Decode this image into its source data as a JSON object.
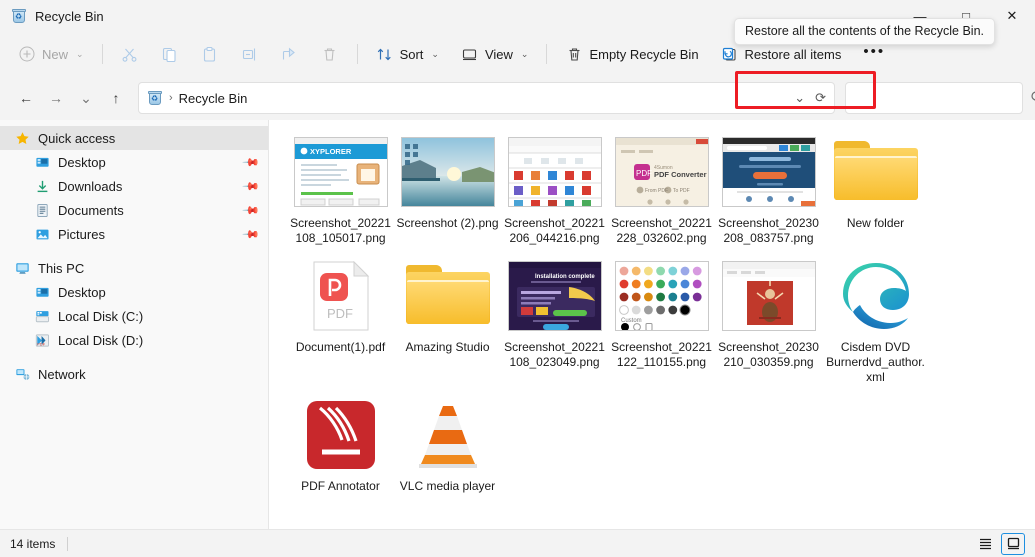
{
  "window": {
    "title": "Recycle Bin",
    "icon": "recycle-bin-icon",
    "controls": {
      "minimize": "—",
      "maximize": "□",
      "close": "✕"
    }
  },
  "toolbar": {
    "new_label": "New",
    "cut_label": "Cut",
    "copy_label": "Copy",
    "paste_label": "Paste",
    "rename_label": "Rename",
    "share_label": "Share",
    "delete_label": "Delete",
    "sort_label": "Sort",
    "view_label": "View",
    "empty_recycle_bin_label": "Empty Recycle Bin",
    "restore_all_items_label": "Restore all items",
    "more_label": "…",
    "tooltip": "Restore all the contents of the Recycle Bin.",
    "highlight_color": "#ed1c24"
  },
  "addressbar": {
    "back": "←",
    "forward": "→",
    "recent": "⌄",
    "up": "↑",
    "crumb_icon": "recycle-bin-icon",
    "crumb": "Recycle Bin",
    "separator": "›",
    "dropdown": "⌄",
    "refresh": "⟳",
    "search_placeholder": ""
  },
  "sidebar": {
    "groups": [
      {
        "header": {
          "label": "Quick access",
          "icon": "star-icon",
          "selected": true
        },
        "items": [
          {
            "label": "Desktop",
            "icon": "desktop-icon",
            "pinned": true
          },
          {
            "label": "Downloads",
            "icon": "downloads-icon",
            "pinned": true
          },
          {
            "label": "Documents",
            "icon": "documents-icon",
            "pinned": true
          },
          {
            "label": "Pictures",
            "icon": "pictures-icon",
            "pinned": true
          }
        ]
      },
      {
        "header": {
          "label": "This PC",
          "icon": "this-pc-icon",
          "selected": false
        },
        "items": [
          {
            "label": "Desktop",
            "icon": "desktop-icon",
            "pinned": false
          },
          {
            "label": "Local Disk (C:)",
            "icon": "drive-icon",
            "pinned": false
          },
          {
            "label": "Local Disk (D:)",
            "icon": "drive-pdf-icon",
            "pinned": false
          }
        ]
      },
      {
        "header": {
          "label": "Network",
          "icon": "network-icon",
          "selected": false
        },
        "items": []
      }
    ]
  },
  "files": [
    {
      "name": "Screenshot_20221108_105017.png",
      "type": "screenshot-xyplorer"
    },
    {
      "name": "Screenshot (2).png",
      "type": "screenshot-desktop-lake"
    },
    {
      "name": "Screenshot_20221206_044216.png",
      "type": "screenshot-icon-grid"
    },
    {
      "name": "Screenshot_20221228_032602.png",
      "type": "screenshot-pdf-converter"
    },
    {
      "name": "Screenshot_20230208_083757.png",
      "type": "screenshot-web-blue"
    },
    {
      "name": "New folder",
      "type": "folder"
    },
    {
      "name": "Document(1).pdf",
      "type": "pdf-file"
    },
    {
      "name": "Amazing Studio",
      "type": "folder"
    },
    {
      "name": "Screenshot_20221108_023049.png",
      "type": "screenshot-install-complete"
    },
    {
      "name": "Screenshot_20221122_110155.png",
      "type": "screenshot-color-picker"
    },
    {
      "name": "Screenshot_20230210_030359.png",
      "type": "screenshot-red-art"
    },
    {
      "name": "Cisdem DVD Burnerdvd_author.xml",
      "type": "edge-icon"
    },
    {
      "name": "PDF Annotator",
      "type": "pdf-annotator-icon"
    },
    {
      "name": "VLC media player",
      "type": "vlc-icon"
    }
  ],
  "statusbar": {
    "item_count": "14 items",
    "list_view_label": "List view",
    "details_view_label": "Large icons view"
  }
}
